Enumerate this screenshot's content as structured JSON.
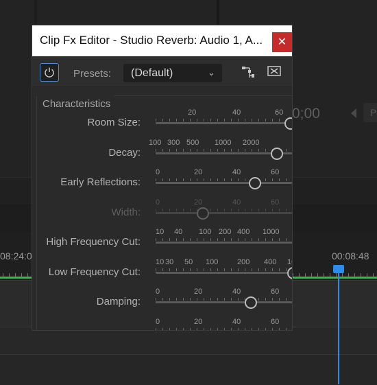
{
  "background": {
    "timecode_partial": "0;00",
    "button_partial": "P",
    "ruler_left": "08:24:0",
    "ruler_right": "00:08:48"
  },
  "dialog": {
    "title": "Clip Fx Editor - Studio Reverb: Audio 1, A...",
    "close_label": "✕",
    "toolbar": {
      "presets_label": "Presets:",
      "preset_value": "(Default)",
      "chevron": "⌄"
    },
    "group_label": "Characteristics",
    "params": [
      {
        "label": "Room Size:",
        "scale": [
          "20",
          "40",
          "60"
        ],
        "value_fraction": 0.98,
        "enabled": true
      },
      {
        "label": "Decay:",
        "scale": [
          "100",
          "300",
          "500",
          "1000",
          "2000"
        ],
        "value_fraction": 0.88,
        "enabled": true
      },
      {
        "label": "Early Reflections:",
        "scale": [
          "0",
          "20",
          "40",
          "60"
        ],
        "value_fraction": 0.72,
        "enabled": true
      },
      {
        "label": "Width:",
        "scale": [
          "0",
          "20",
          "40",
          "60"
        ],
        "value_fraction": 0.34,
        "enabled": false
      },
      {
        "label": "High Frequency Cut:",
        "scale": [
          "10",
          "40",
          "100",
          "200",
          "400",
          "1000"
        ],
        "value_fraction": null,
        "enabled": true
      },
      {
        "label": "Low Frequency Cut:",
        "scale": [
          "10",
          "30",
          "50",
          "100",
          "200",
          "400",
          "10"
        ],
        "value_fraction": 1.0,
        "enabled": true
      },
      {
        "label": "Damping:",
        "scale": [
          "0",
          "20",
          "40",
          "60"
        ],
        "value_fraction": 0.69,
        "enabled": true
      },
      {
        "label": "",
        "scale": [
          "0",
          "20",
          "40",
          "60"
        ],
        "value_fraction": null,
        "enabled": true
      }
    ]
  },
  "colors": {
    "accent_blue": "#2d8ceb",
    "green_line": "#2fbf3f",
    "close_red": "#c42b2b"
  }
}
